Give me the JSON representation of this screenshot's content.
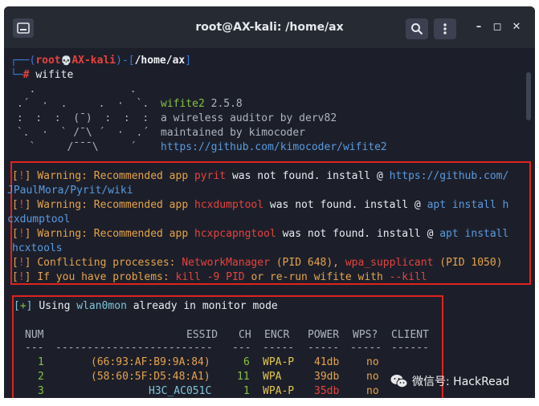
{
  "window": {
    "title": "root@AX-kali: /home/ax",
    "minimize": "–",
    "maximize": "◻",
    "close": "✕"
  },
  "prompt": {
    "open": "┌──(",
    "user": "root",
    "skull": "💀",
    "host": "AX-kali",
    "close": ")-[",
    "path": "/home/ax",
    "path_close": "]",
    "hash_prefix": "└─",
    "hash": "#",
    "command": "wifite"
  },
  "banner": {
    "art": [
      "   .               .    ",
      " .´  ·  .     .  ·  `.  ",
      " :  :  :  (¯)  :  :  :  ",
      " `.  ·  ` /¯\\ ´  ·  .´  ",
      "   `     /¯¯¯\\     ´    "
    ],
    "name": "wifite2",
    "version": "2.5.8",
    "line2": "a wireless auditor by derv82",
    "line3": "maintained by kimocoder",
    "line4": "https://github.com/kimocoder/wifite2"
  },
  "warnings": [
    {
      "mark": "!",
      "label": "Warning: Recommended app",
      "app": "pyrit",
      "text": "was not found. install @",
      "link": "https://github.com/",
      "cont": "JPaulMora/Pyrit/wiki"
    },
    {
      "mark": "!",
      "label": "Warning: Recommended app",
      "app": "hcxdumptool",
      "text": "was not found. install @",
      "link": "apt install h",
      "cont": "cxdumptool"
    },
    {
      "mark": "!",
      "label": "Warning: Recommended app",
      "app": "hcxpcapngtool",
      "text": "was not found. install @",
      "link": "apt install",
      "cont": "hcxtools"
    }
  ],
  "conflict": {
    "mark": "!",
    "label": "Conflicting processes:",
    "p1": "NetworkManager",
    "pid1": "(PID 648),",
    "p2": "wpa_supplicant",
    "pid2": "(PID 1050)"
  },
  "problems": {
    "mark": "!",
    "label": "If you have problems:",
    "cmd": "kill -9 PID",
    "mid": "or re-run wifite with",
    "flag": "--kill"
  },
  "monitor": {
    "mark": "+",
    "pre": "Using",
    "iface": "wlan0mon",
    "post": "already in monitor mode"
  },
  "table": {
    "headers": {
      "num": "NUM",
      "essid": "ESSID",
      "ch": "CH",
      "encr": "ENCR",
      "power": "POWER",
      "wps": "WPS?",
      "client": "CLIENT"
    },
    "rules": {
      "num": "---",
      "essid": "-------------------------",
      "ch": "---",
      "encr": "-----",
      "power": "-----",
      "wps": "-----",
      "client": "------"
    },
    "rows": [
      {
        "num": "1",
        "essid": "(66:93:AF:B9:9A:84)",
        "ch": "6",
        "encr": "WPA-P",
        "power": "41db",
        "wps": "no"
      },
      {
        "num": "2",
        "essid": "(58:60:5F:D5:48:A1)",
        "ch": "11",
        "encr": "WPA",
        "power": "39db",
        "wps": "no"
      },
      {
        "num": "3",
        "essid": "H3C_AC051C",
        "ch": "1",
        "encr": "WPA-P",
        "power": "35db",
        "wps": "no"
      }
    ]
  },
  "watermark": {
    "text": "微信号: HackRead",
    "icon": "wechat-icon"
  }
}
